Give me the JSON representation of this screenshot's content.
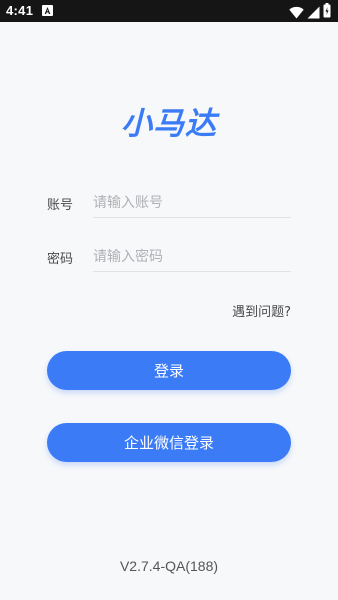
{
  "status_bar": {
    "time": "4:41",
    "icons": [
      "app-notification-icon",
      "wifi-icon",
      "signal-icon",
      "battery-icon"
    ]
  },
  "app": {
    "logo_text": "小马达",
    "brand_color": "#3b7bf6"
  },
  "login_form": {
    "account_label": "账号",
    "account_placeholder": "请输入账号",
    "account_value": "",
    "password_label": "密码",
    "password_placeholder": "请输入密码",
    "password_value": "",
    "help_link": "遇到问题?",
    "login_button": "登录",
    "wecom_login_button": "企业微信登录"
  },
  "footer": {
    "version": "V2.7.4-QA(188)"
  }
}
